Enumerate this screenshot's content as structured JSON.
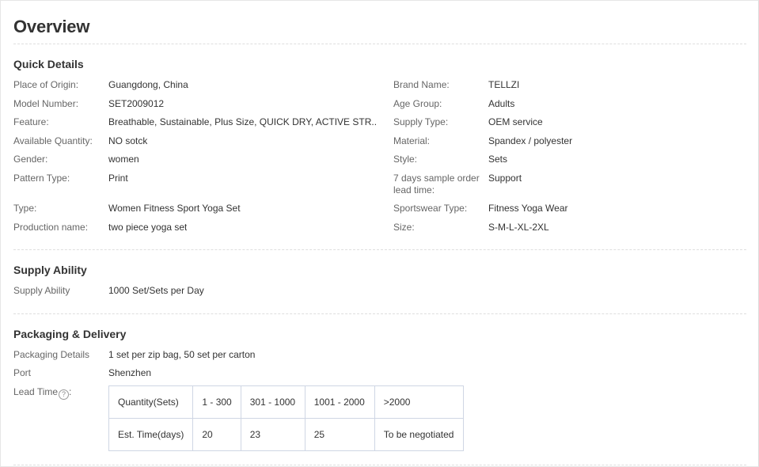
{
  "overview_title": "Overview",
  "quick_details": {
    "title": "Quick Details",
    "left": [
      {
        "label": "Place of Origin:",
        "value": "Guangdong, China"
      },
      {
        "label": "Model Number:",
        "value": "SET2009012"
      },
      {
        "label": "Feature:",
        "value": "Breathable, Sustainable, Plus Size, QUICK DRY, ACTIVE STR..."
      },
      {
        "label": "Available Quantity:",
        "value": "NO sotck"
      },
      {
        "label": "Gender:",
        "value": "women"
      },
      {
        "label": "Pattern Type:",
        "value": "Print"
      },
      {
        "label": "Type:",
        "value": "Women Fitness Sport Yoga Set"
      },
      {
        "label": "Production name:",
        "value": "two piece yoga set"
      }
    ],
    "right": [
      {
        "label": "Brand Name:",
        "value": "TELLZI"
      },
      {
        "label": "Age Group:",
        "value": "Adults"
      },
      {
        "label": "Supply Type:",
        "value": "OEM service"
      },
      {
        "label": "Material:",
        "value": "Spandex / polyester"
      },
      {
        "label": "Style:",
        "value": "Sets"
      },
      {
        "label_line1": "7 days sample order",
        "label_line2": "lead time:",
        "value": "Support"
      },
      {
        "label": "Sportswear Type:",
        "value": "Fitness Yoga Wear"
      },
      {
        "label": "Size:",
        "value": "S-M-L-XL-2XL"
      }
    ]
  },
  "supply_ability": {
    "title": "Supply Ability",
    "label": "Supply Ability",
    "value": "1000 Set/Sets per Day"
  },
  "packaging": {
    "title": "Packaging & Delivery",
    "details_label": "Packaging Details",
    "details_value": "1 set per zip bag, 50 set per carton",
    "port_label": "Port",
    "port_value": "Shenzhen",
    "lead_time_label": "Lead Time",
    "lead_time_suffix": ":",
    "help_glyph": "?",
    "lead_table": {
      "header": [
        "Quantity(Sets)",
        "1 - 300",
        "301 - 1000",
        "1001 - 2000",
        ">2000"
      ],
      "row": [
        "Est. Time(days)",
        "20",
        "23",
        "25",
        "To be negotiated"
      ]
    }
  }
}
